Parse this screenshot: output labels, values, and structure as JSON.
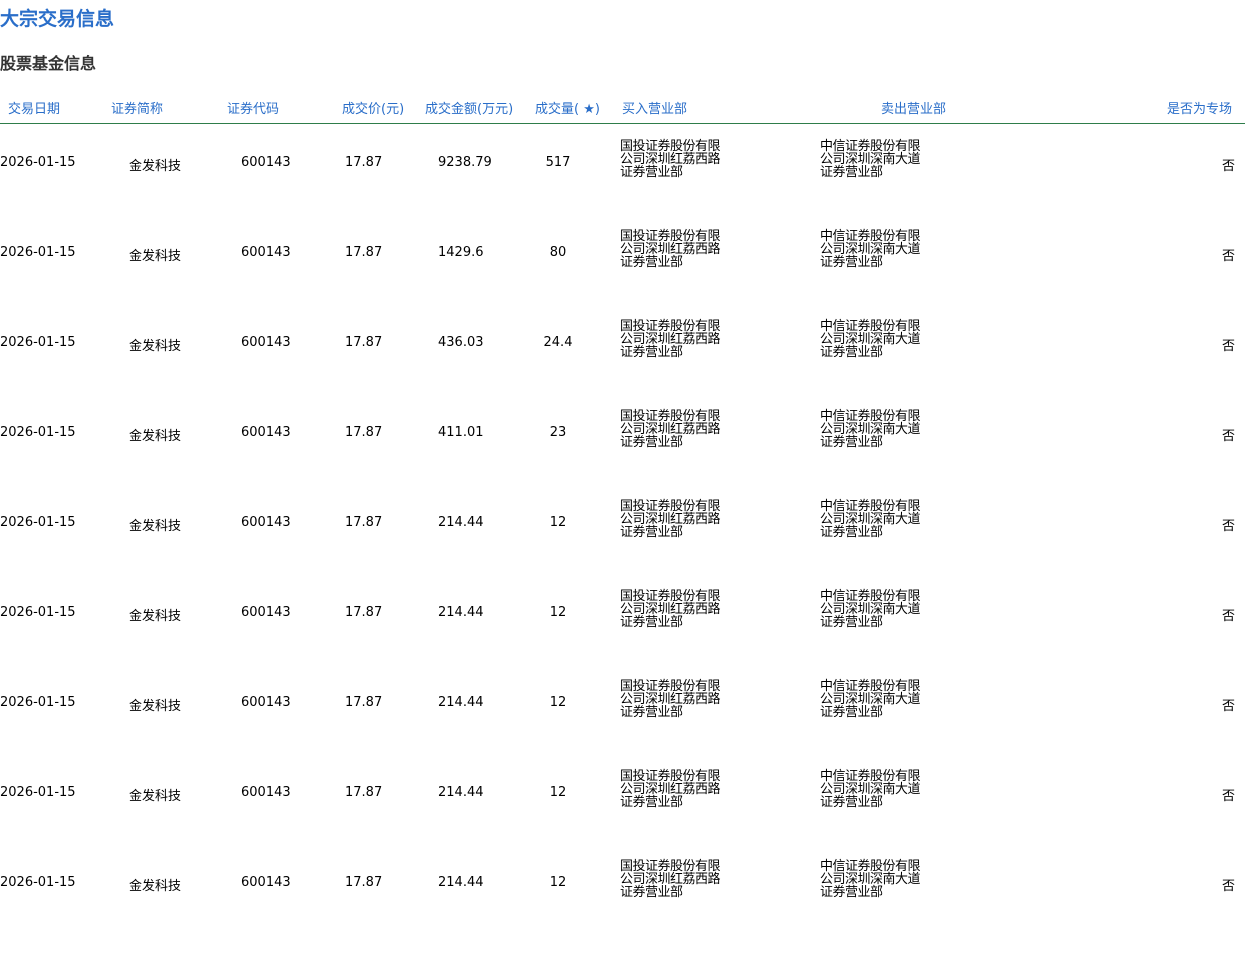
{
  "page": {
    "title": "大宗交易信息",
    "section_title": "股票基金信息"
  },
  "table": {
    "headers": {
      "date": "交易日期",
      "name": "证券简称",
      "code": "证券代码",
      "price": "成交价(元)",
      "amount": "成交金额(万元)",
      "volume": "成交量( ★)",
      "buy_dept": "买入营业部",
      "sell_dept": "卖出营业部",
      "special": "是否为专场"
    },
    "rows": [
      {
        "date": "2026-01-15",
        "name": "金发科技",
        "code": "600143",
        "price": "17.87",
        "amount": "9238.79",
        "volume": "517",
        "buy_dept": "国投证券股份有限公司深圳红荔西路证券营业部",
        "sell_dept": "中信证券股份有限公司深圳深南大道证券营业部",
        "special": "否"
      },
      {
        "date": "2026-01-15",
        "name": "金发科技",
        "code": "600143",
        "price": "17.87",
        "amount": "1429.6",
        "volume": "80",
        "buy_dept": "国投证券股份有限公司深圳红荔西路证券营业部",
        "sell_dept": "中信证券股份有限公司深圳深南大道证券营业部",
        "special": "否"
      },
      {
        "date": "2026-01-15",
        "name": "金发科技",
        "code": "600143",
        "price": "17.87",
        "amount": "436.03",
        "volume": "24.4",
        "buy_dept": "国投证券股份有限公司深圳红荔西路证券营业部",
        "sell_dept": "中信证券股份有限公司深圳深南大道证券营业部",
        "special": "否"
      },
      {
        "date": "2026-01-15",
        "name": "金发科技",
        "code": "600143",
        "price": "17.87",
        "amount": "411.01",
        "volume": "23",
        "buy_dept": "国投证券股份有限公司深圳红荔西路证券营业部",
        "sell_dept": "中信证券股份有限公司深圳深南大道证券营业部",
        "special": "否"
      },
      {
        "date": "2026-01-15",
        "name": "金发科技",
        "code": "600143",
        "price": "17.87",
        "amount": "214.44",
        "volume": "12",
        "buy_dept": "国投证券股份有限公司深圳红荔西路证券营业部",
        "sell_dept": "中信证券股份有限公司深圳深南大道证券营业部",
        "special": "否"
      },
      {
        "date": "2026-01-15",
        "name": "金发科技",
        "code": "600143",
        "price": "17.87",
        "amount": "214.44",
        "volume": "12",
        "buy_dept": "国投证券股份有限公司深圳红荔西路证券营业部",
        "sell_dept": "中信证券股份有限公司深圳深南大道证券营业部",
        "special": "否"
      },
      {
        "date": "2026-01-15",
        "name": "金发科技",
        "code": "600143",
        "price": "17.87",
        "amount": "214.44",
        "volume": "12",
        "buy_dept": "国投证券股份有限公司深圳红荔西路证券营业部",
        "sell_dept": "中信证券股份有限公司深圳深南大道证券营业部",
        "special": "否"
      },
      {
        "date": "2026-01-15",
        "name": "金发科技",
        "code": "600143",
        "price": "17.87",
        "amount": "214.44",
        "volume": "12",
        "buy_dept": "国投证券股份有限公司深圳红荔西路证券营业部",
        "sell_dept": "中信证券股份有限公司深圳深南大道证券营业部",
        "special": "否"
      },
      {
        "date": "2026-01-15",
        "name": "金发科技",
        "code": "600143",
        "price": "17.87",
        "amount": "214.44",
        "volume": "12",
        "buy_dept": "国投证券股份有限公司深圳红荔西路证券营业部",
        "sell_dept": "中信证券股份有限公司深圳深南大道证券营业部",
        "special": "否"
      }
    ]
  },
  "colors": {
    "title": "#2a6ec9",
    "header_text": "#2a6ec9",
    "header_rule": "#2e7d4a"
  }
}
